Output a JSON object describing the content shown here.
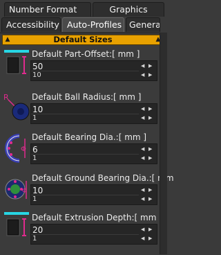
{
  "tabs": {
    "row1": [
      "Number Format",
      "Graphics"
    ],
    "row2": [
      "Accessibility",
      "Auto-Profiles",
      "General"
    ]
  },
  "section": {
    "title": "Default Sizes"
  },
  "params": [
    {
      "label": "Default Part-Offset:[ mm ]",
      "value": "50",
      "step": "10"
    },
    {
      "label": "Default Ball Radius:[ mm ]",
      "value": "10",
      "step": "1"
    },
    {
      "label": "Default Bearing Dia.:[ mm ]",
      "value": "6",
      "step": "1"
    },
    {
      "label": "Default Ground Bearing Dia.:[ mm",
      "value": "10",
      "step": "1"
    },
    {
      "label": "Default Extrusion Depth:[ mm ]",
      "value": "20",
      "step": "1"
    }
  ],
  "colors": {
    "accent": "#e8a100",
    "cyan": "#27d6e4",
    "magenta": "#e02b8e"
  }
}
